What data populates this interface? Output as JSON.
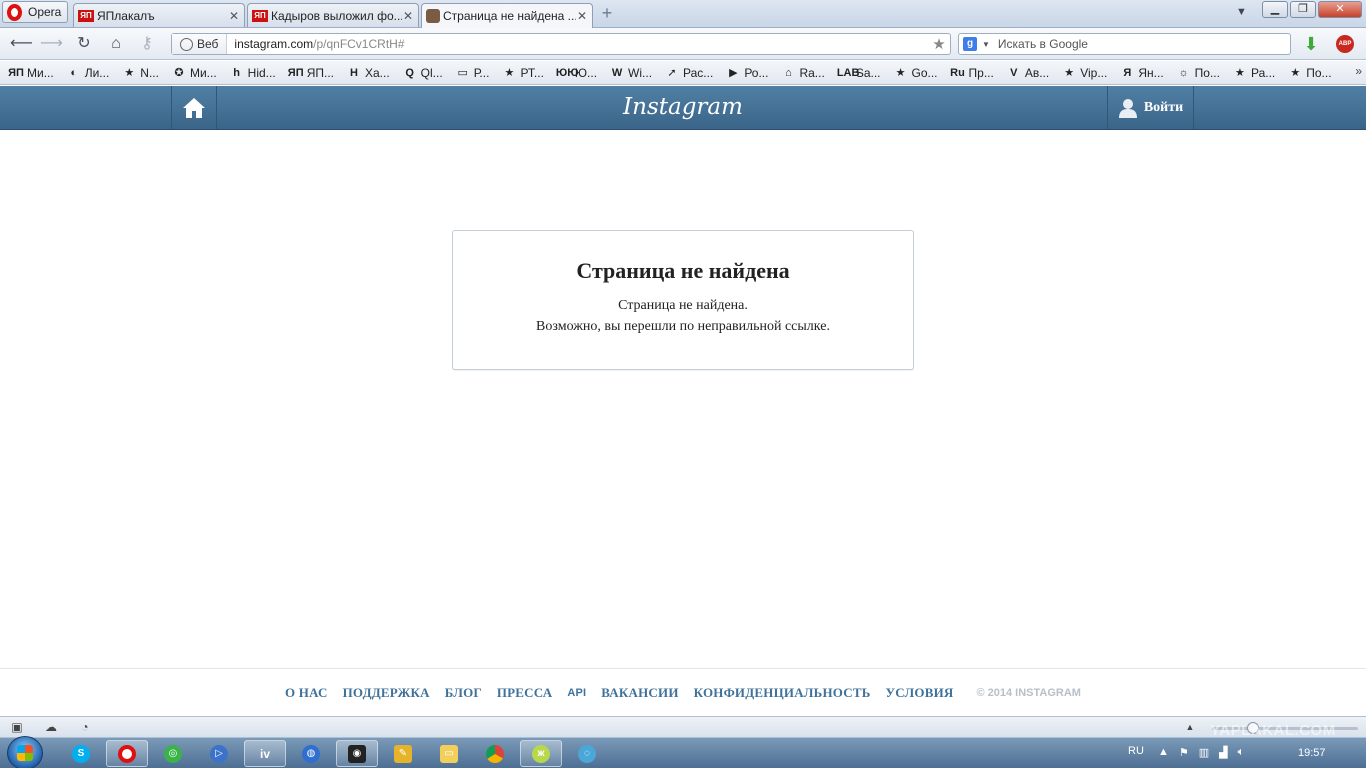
{
  "browser": {
    "menu_label": "Opera",
    "tabs": [
      {
        "favicon": "ЯП",
        "title": "ЯПлакалъ",
        "close": "✕"
      },
      {
        "favicon": "ЯП",
        "title": "Кадыров выложил фо...",
        "close": "✕"
      },
      {
        "favicon": "",
        "title": "Страница не найдена ...",
        "close": "✕"
      }
    ],
    "new_tab": "+",
    "address": {
      "web_label": "Веб",
      "url_host": "instagram.com",
      "url_path": "/p/qnFCv1CRtH#"
    },
    "search": {
      "engine": "g",
      "placeholder": "Искать в Google"
    },
    "adblock_label": "ABP",
    "bookmarks": [
      {
        "icon": "ЯП",
        "label": "Ми..."
      },
      {
        "icon": "◐",
        "label": "Ли..."
      },
      {
        "icon": "★",
        "label": "N..."
      },
      {
        "icon": "✪",
        "label": "Ми..."
      },
      {
        "icon": "h",
        "label": "Hid..."
      },
      {
        "icon": "ЯП",
        "label": "ЯП..."
      },
      {
        "icon": "H",
        "label": "Ха..."
      },
      {
        "icon": "Q",
        "label": "Ql..."
      },
      {
        "icon": "▭",
        "label": "Р..."
      },
      {
        "icon": "★",
        "label": "РТ..."
      },
      {
        "icon": "ЮЮ",
        "label": "Ю..."
      },
      {
        "icon": "W",
        "label": "Wi..."
      },
      {
        "icon": "➚",
        "label": "Рас..."
      },
      {
        "icon": "▶",
        "label": "Ро..."
      },
      {
        "icon": "⌂",
        "label": "Ra..."
      },
      {
        "icon": "LAB",
        "label": "Sa..."
      },
      {
        "icon": "★",
        "label": "Go..."
      },
      {
        "icon": "Ru",
        "label": "Пр..."
      },
      {
        "icon": "V",
        "label": "Ав..."
      },
      {
        "icon": "★",
        "label": "Vip..."
      },
      {
        "icon": "Я",
        "label": "Ян..."
      },
      {
        "icon": "☼",
        "label": "По..."
      },
      {
        "icon": "★",
        "label": "Ра..."
      },
      {
        "icon": "★",
        "label": "По..."
      }
    ],
    "bookmarks_more": "»"
  },
  "instagram": {
    "logo": "Instagram",
    "login_label": "Войти",
    "error_title": "Страница не найдена",
    "error_line1": "Страница не найдена.",
    "error_line2": "Возможно, вы перешли по неправильной ссылке.",
    "footer_links": [
      "О НАС",
      "ПОДДЕРЖКА",
      "БЛОГ",
      "ПРЕССА",
      "API",
      "ВАКАНСИИ",
      "КОНФИДЕНЦИАЛЬНОСТЬ",
      "УСЛОВИЯ"
    ],
    "copyright": "© 2014 INSTAGRAM",
    "link_color": "#3f729b",
    "header_color": "#517fa4"
  },
  "taskbar": {
    "language": "RU",
    "clock": "19:57",
    "watermark": "YAPLAKAL.COM"
  }
}
